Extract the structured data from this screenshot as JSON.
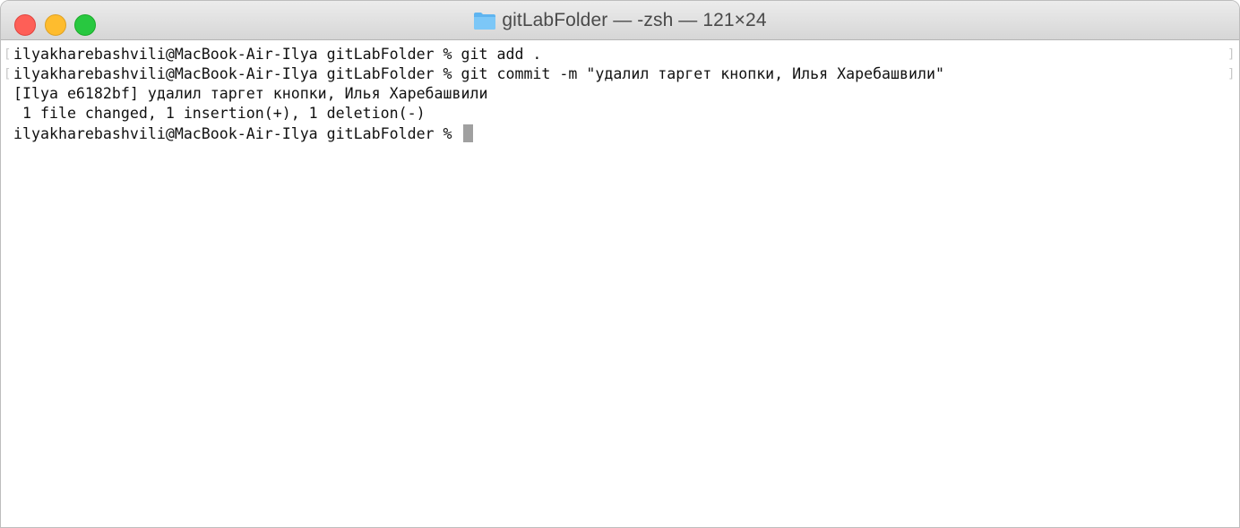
{
  "window": {
    "title": "gitLabFolder — -zsh — 121×24"
  },
  "icons": {
    "title_icon": "folder-icon",
    "close": "close-button",
    "minimize": "minimize-button",
    "maximize": "maximize-button"
  },
  "colors": {
    "close": "#fe5f57",
    "minimize": "#febc2e",
    "maximize": "#28c840",
    "folder": "#5eb4f0",
    "cursor": "#a0a0a0"
  },
  "terminal": {
    "lines": [
      "ilyakharebashvili@MacBook-Air-Ilya gitLabFolder % git add .",
      "ilyakharebashvili@MacBook-Air-Ilya gitLabFolder % git commit -m \"удалил таргет кнопки, Илья Харебашвили\"",
      "[Ilya e6182bf] удалил таргет кнопки, Илья Харебашвили",
      " 1 file changed, 1 insertion(+), 1 deletion(-)",
      "ilyakharebashvili@MacBook-Air-Ilya gitLabFolder % "
    ]
  }
}
